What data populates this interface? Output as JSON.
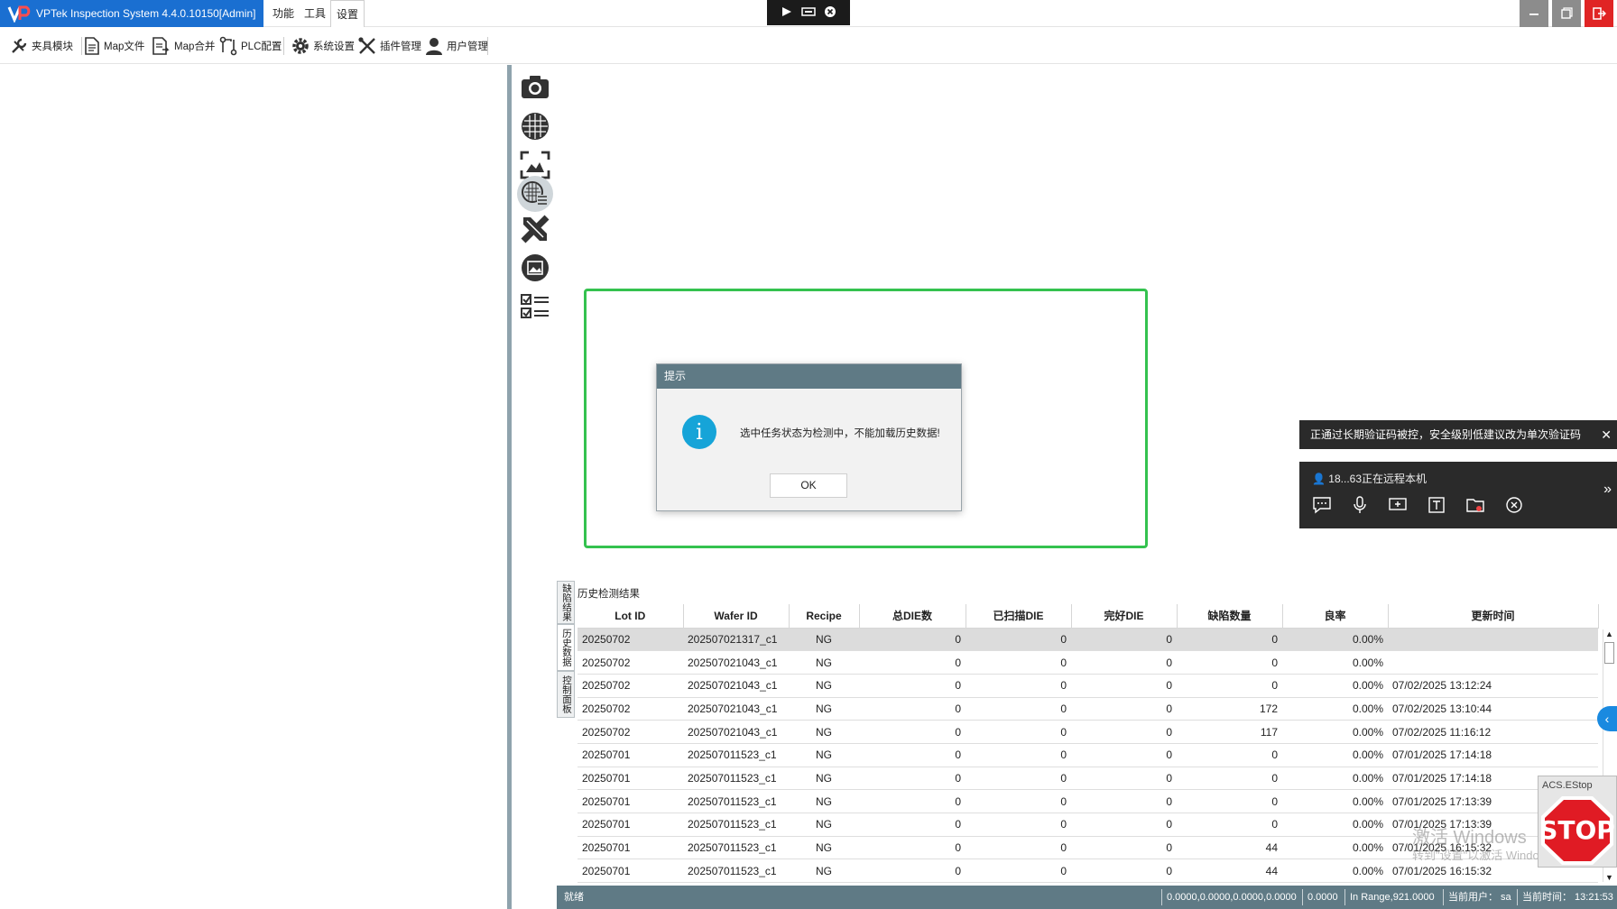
{
  "app": {
    "title": "VPTek Inspection System 4.4.0.10150[Admin]",
    "accent_color": "#1a6fd1"
  },
  "menu": {
    "items": [
      "功能",
      "工具",
      "设置"
    ],
    "active": "设置"
  },
  "toolbar": {
    "items": [
      {
        "label": "夹具模块",
        "icon": "tools-icon"
      },
      {
        "label": "Map文件",
        "icon": "document-icon"
      },
      {
        "label": "Map合并",
        "icon": "merge-document-icon"
      },
      {
        "label": "PLC配置",
        "icon": "plc-icon"
      },
      {
        "label": "系统设置",
        "icon": "gear-icon"
      },
      {
        "label": "插件管理",
        "icon": "wrench-cross-icon"
      },
      {
        "label": "用户管理",
        "icon": "user-icon"
      }
    ]
  },
  "icon_strip": [
    "camera-icon",
    "wafer-grid-icon",
    "image-scan-icon",
    "wafer-list-icon",
    "ruler-pencil-icon",
    "picture-icon",
    "checklist-icon"
  ],
  "dialog": {
    "title": "提示",
    "message": "选中任务状态为检测中，不能加载历史数据!",
    "ok_label": "OK"
  },
  "remote": {
    "notice": "正通过长期验证码被控，安全级别低建议改为单次验证码",
    "user_text": "18...63正在远程本机"
  },
  "results": {
    "side_tabs": [
      "缺陷结果",
      "历史数据",
      "控制面板"
    ],
    "label": "历史检测结果",
    "columns": [
      "Lot ID",
      "Wafer ID",
      "Recipe",
      "总DIE数",
      "已扫描DIE",
      "完好DIE",
      "缺陷数量",
      "良率",
      "更新时间"
    ],
    "rows": [
      [
        "20250702",
        "202507021317_c1",
        "NG",
        "0",
        "0",
        "0",
        "0",
        "0.00%",
        ""
      ],
      [
        "20250702",
        "202507021043_c1",
        "NG",
        "0",
        "0",
        "0",
        "0",
        "0.00%",
        ""
      ],
      [
        "20250702",
        "202507021043_c1",
        "NG",
        "0",
        "0",
        "0",
        "0",
        "0.00%",
        "07/02/2025 13:12:24"
      ],
      [
        "20250702",
        "202507021043_c1",
        "NG",
        "0",
        "0",
        "0",
        "172",
        "0.00%",
        "07/02/2025 13:10:44"
      ],
      [
        "20250702",
        "202507021043_c1",
        "NG",
        "0",
        "0",
        "0",
        "117",
        "0.00%",
        "07/02/2025 11:16:12"
      ],
      [
        "20250701",
        "202507011523_c1",
        "NG",
        "0",
        "0",
        "0",
        "0",
        "0.00%",
        "07/01/2025 17:14:18"
      ],
      [
        "20250701",
        "202507011523_c1",
        "NG",
        "0",
        "0",
        "0",
        "0",
        "0.00%",
        "07/01/2025 17:14:18"
      ],
      [
        "20250701",
        "202507011523_c1",
        "NG",
        "0",
        "0",
        "0",
        "0",
        "0.00%",
        "07/01/2025 17:13:39"
      ],
      [
        "20250701",
        "202507011523_c1",
        "NG",
        "0",
        "0",
        "0",
        "0",
        "0.00%",
        "07/01/2025 17:13:39"
      ],
      [
        "20250701",
        "202507011523_c1",
        "NG",
        "0",
        "0",
        "0",
        "44",
        "0.00%",
        "07/01/2025 16:15:32"
      ],
      [
        "20250701",
        "202507011523_c1",
        "NG",
        "0",
        "0",
        "0",
        "44",
        "0.00%",
        "07/01/2025 16:15:32"
      ]
    ],
    "selected_row": 0
  },
  "estop": {
    "label": "ACS.EStop",
    "text": "STOP"
  },
  "watermark": {
    "line1": "激活 Windows",
    "line2": "转到\"设置\"以激活 Windows。"
  },
  "status": {
    "state": "就绪",
    "coords": "0.0000,0.0000,0.0000,0.0000",
    "value": "0.0000",
    "range": "In Range,921.0000",
    "user": "当前用户： sa",
    "time": "当前时间： 13:21:53"
  }
}
